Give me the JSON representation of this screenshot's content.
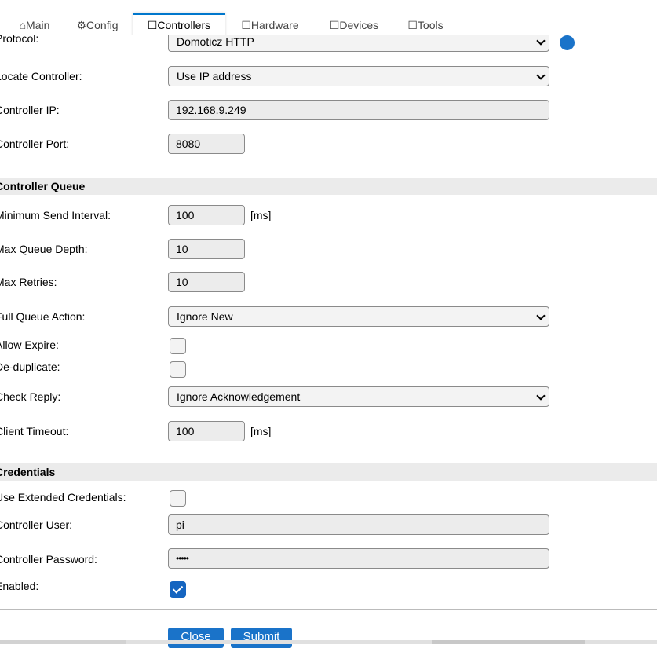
{
  "tabs": [
    {
      "label": "⌂Main"
    },
    {
      "label": "⚙Config"
    },
    {
      "label": "☐Controllers"
    },
    {
      "label": "☐Hardware"
    },
    {
      "label": "☐Devices"
    },
    {
      "label": "☐Tools"
    }
  ],
  "active_tab": "☐Controllers",
  "controller": {
    "protocol_label": "Protocol:",
    "protocol_value": "Domoticz HTTP",
    "locate_label": "Locate Controller:",
    "locate_value": "Use IP address",
    "ip_label": "Controller IP:",
    "ip_value": "192.168.9.249",
    "port_label": "Controller Port:",
    "port_value": "8080"
  },
  "queue": {
    "section_title": "Controller Queue",
    "min_interval_label": "Minimum Send Interval:",
    "min_interval_value": "100",
    "min_interval_unit": "[ms]",
    "max_depth_label": "Max Queue Depth:",
    "max_depth_value": "10",
    "max_retries_label": "Max Retries:",
    "max_retries_value": "10",
    "full_action_label": "Full Queue Action:",
    "full_action_value": "Ignore New",
    "allow_expire_label": "Allow Expire:",
    "allow_expire_checked": false,
    "dedup_label": "De-duplicate:",
    "dedup_checked": false,
    "check_reply_label": "Check Reply:",
    "check_reply_value": "Ignore Acknowledgement",
    "timeout_label": "Client Timeout:",
    "timeout_value": "100",
    "timeout_unit": "[ms]"
  },
  "credentials": {
    "section_title": "Credentials",
    "extended_label": "Use Extended Credentials:",
    "extended_checked": false,
    "user_label": "Controller User:",
    "user_value": "pi",
    "password_label": "Controller Password:",
    "password_value": "•••••",
    "enabled_label": "Enabled:",
    "enabled_checked": true
  },
  "buttons": {
    "close_label": "Close",
    "submit_label": "Submit"
  },
  "colors": {
    "accent": "#1a73c9",
    "checkbox_checked": "#1565c0",
    "section_bg": "#ebebeb"
  }
}
